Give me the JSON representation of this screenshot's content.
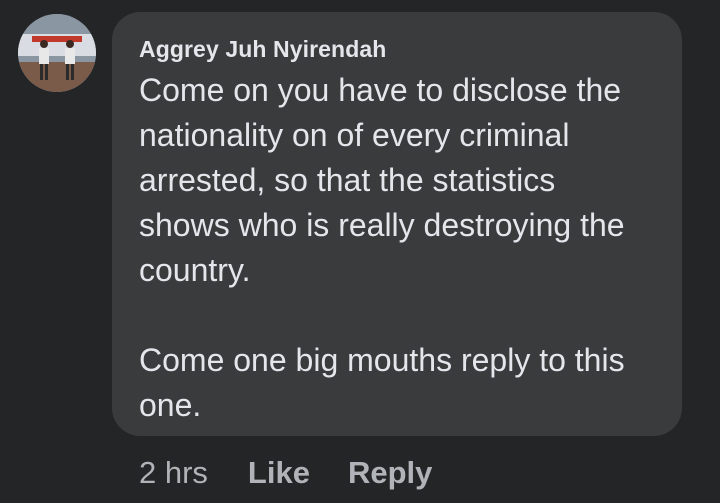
{
  "comment": {
    "author": "Aggrey Juh Nyirendah",
    "paragraphs": [
      [
        "Come on you have to disclose the",
        "nationality on of every criminal",
        "arrested, so that the statistics",
        "shows who is really destroying the",
        "country."
      ],
      [
        "Come one big mouths reply to this",
        "one."
      ]
    ],
    "timestamp": "2 hrs",
    "like_label": "Like",
    "reply_label": "Reply"
  },
  "colors": {
    "background": "#242526",
    "bubble": "#3a3b3c",
    "text": "#e4e6eb",
    "meta": "#b0b3b8"
  }
}
